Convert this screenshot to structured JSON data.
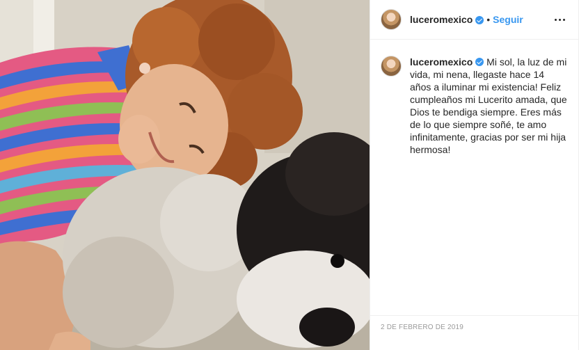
{
  "post": {
    "username": "luceromexico",
    "follow_label": "Seguir",
    "separator": "•",
    "caption": "Mi sol, la luz de mi vida, mi nena, llegaste hace 14 años a iluminar mi existencia! Feliz cumpleaños mi Lucerito amada, que Dios te bendiga siempre. Eres más de lo que siempre soñé, te amo infinitamente, gracias por ser mi hija hermosa!",
    "date": "2 de febrero de 2019"
  },
  "icons": {
    "verified": "verified-badge-icon",
    "more": "more-options-icon"
  },
  "colors": {
    "link_blue": "#3897f0",
    "text": "#262626",
    "muted": "#999999"
  }
}
